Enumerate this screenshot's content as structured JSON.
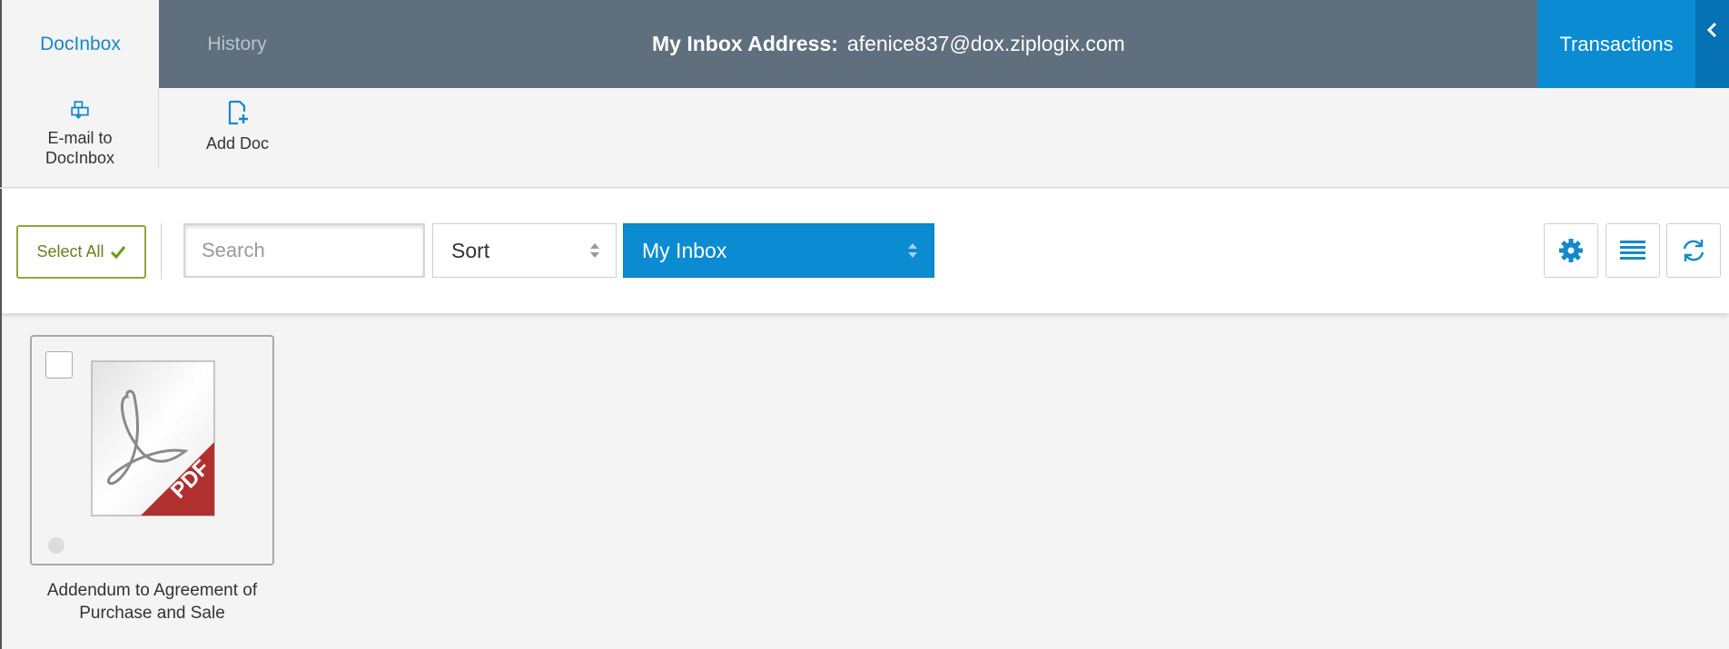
{
  "header": {
    "tabs": [
      {
        "label": "DocInbox",
        "active": true
      },
      {
        "label": "History",
        "active": false
      }
    ],
    "inbox_address_label": "My Inbox Address:",
    "inbox_address": "afenice837@dox.ziplogix.com",
    "transactions_label": "Transactions",
    "collapse_icon": "chevron-left-icon"
  },
  "actions": [
    {
      "label": "E-mail to DocInbox",
      "icon": "email-to-inbox-icon"
    },
    {
      "label": "Add Doc",
      "icon": "add-document-icon"
    }
  ],
  "toolbar": {
    "select_all_label": "Select All",
    "search_placeholder": "Search",
    "sort_value": "Sort",
    "inbox_filter_value": "My Inbox",
    "icon_buttons": [
      "gear-icon",
      "list-view-icon",
      "refresh-icon"
    ]
  },
  "documents": [
    {
      "title": "Addendum to Agreement of Purchase and Sale",
      "type_badge": "PDF",
      "checked": false
    }
  ],
  "colors": {
    "header_bg": "#5f6f7e",
    "accent_blue": "#0a8bd2",
    "select_all_green": "#8fa63a",
    "pdf_red": "#b03030"
  }
}
